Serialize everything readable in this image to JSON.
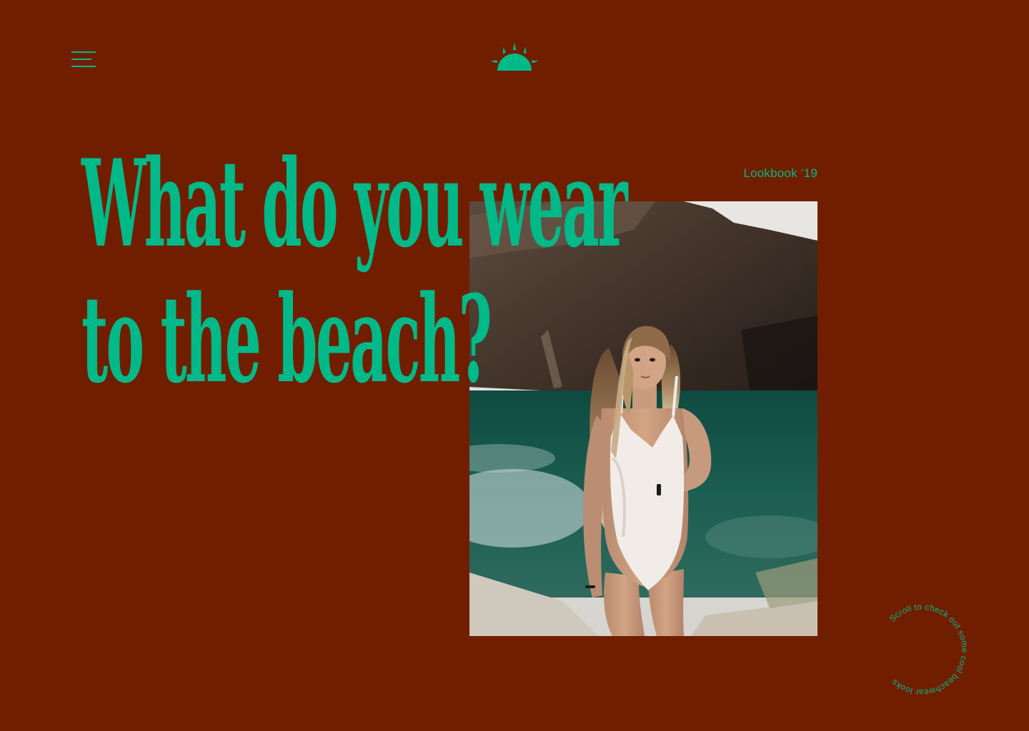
{
  "theme": {
    "background": "#711e00",
    "accent": "#00b988"
  },
  "header": {
    "menu_icon": "hamburger-menu-icon",
    "logo_icon": "rising-sun-icon"
  },
  "hero": {
    "headline_line1": "What do you wear",
    "headline_line2": "to the beach?",
    "lookbook_label": "Lookbook ‘19",
    "photo_subject": "woman in a white one-piece swimsuit standing by a green lake"
  },
  "scroll_cue": {
    "text": "Scroll to check out some cool beachwear looks",
    "icon": "circular-text-badge"
  }
}
